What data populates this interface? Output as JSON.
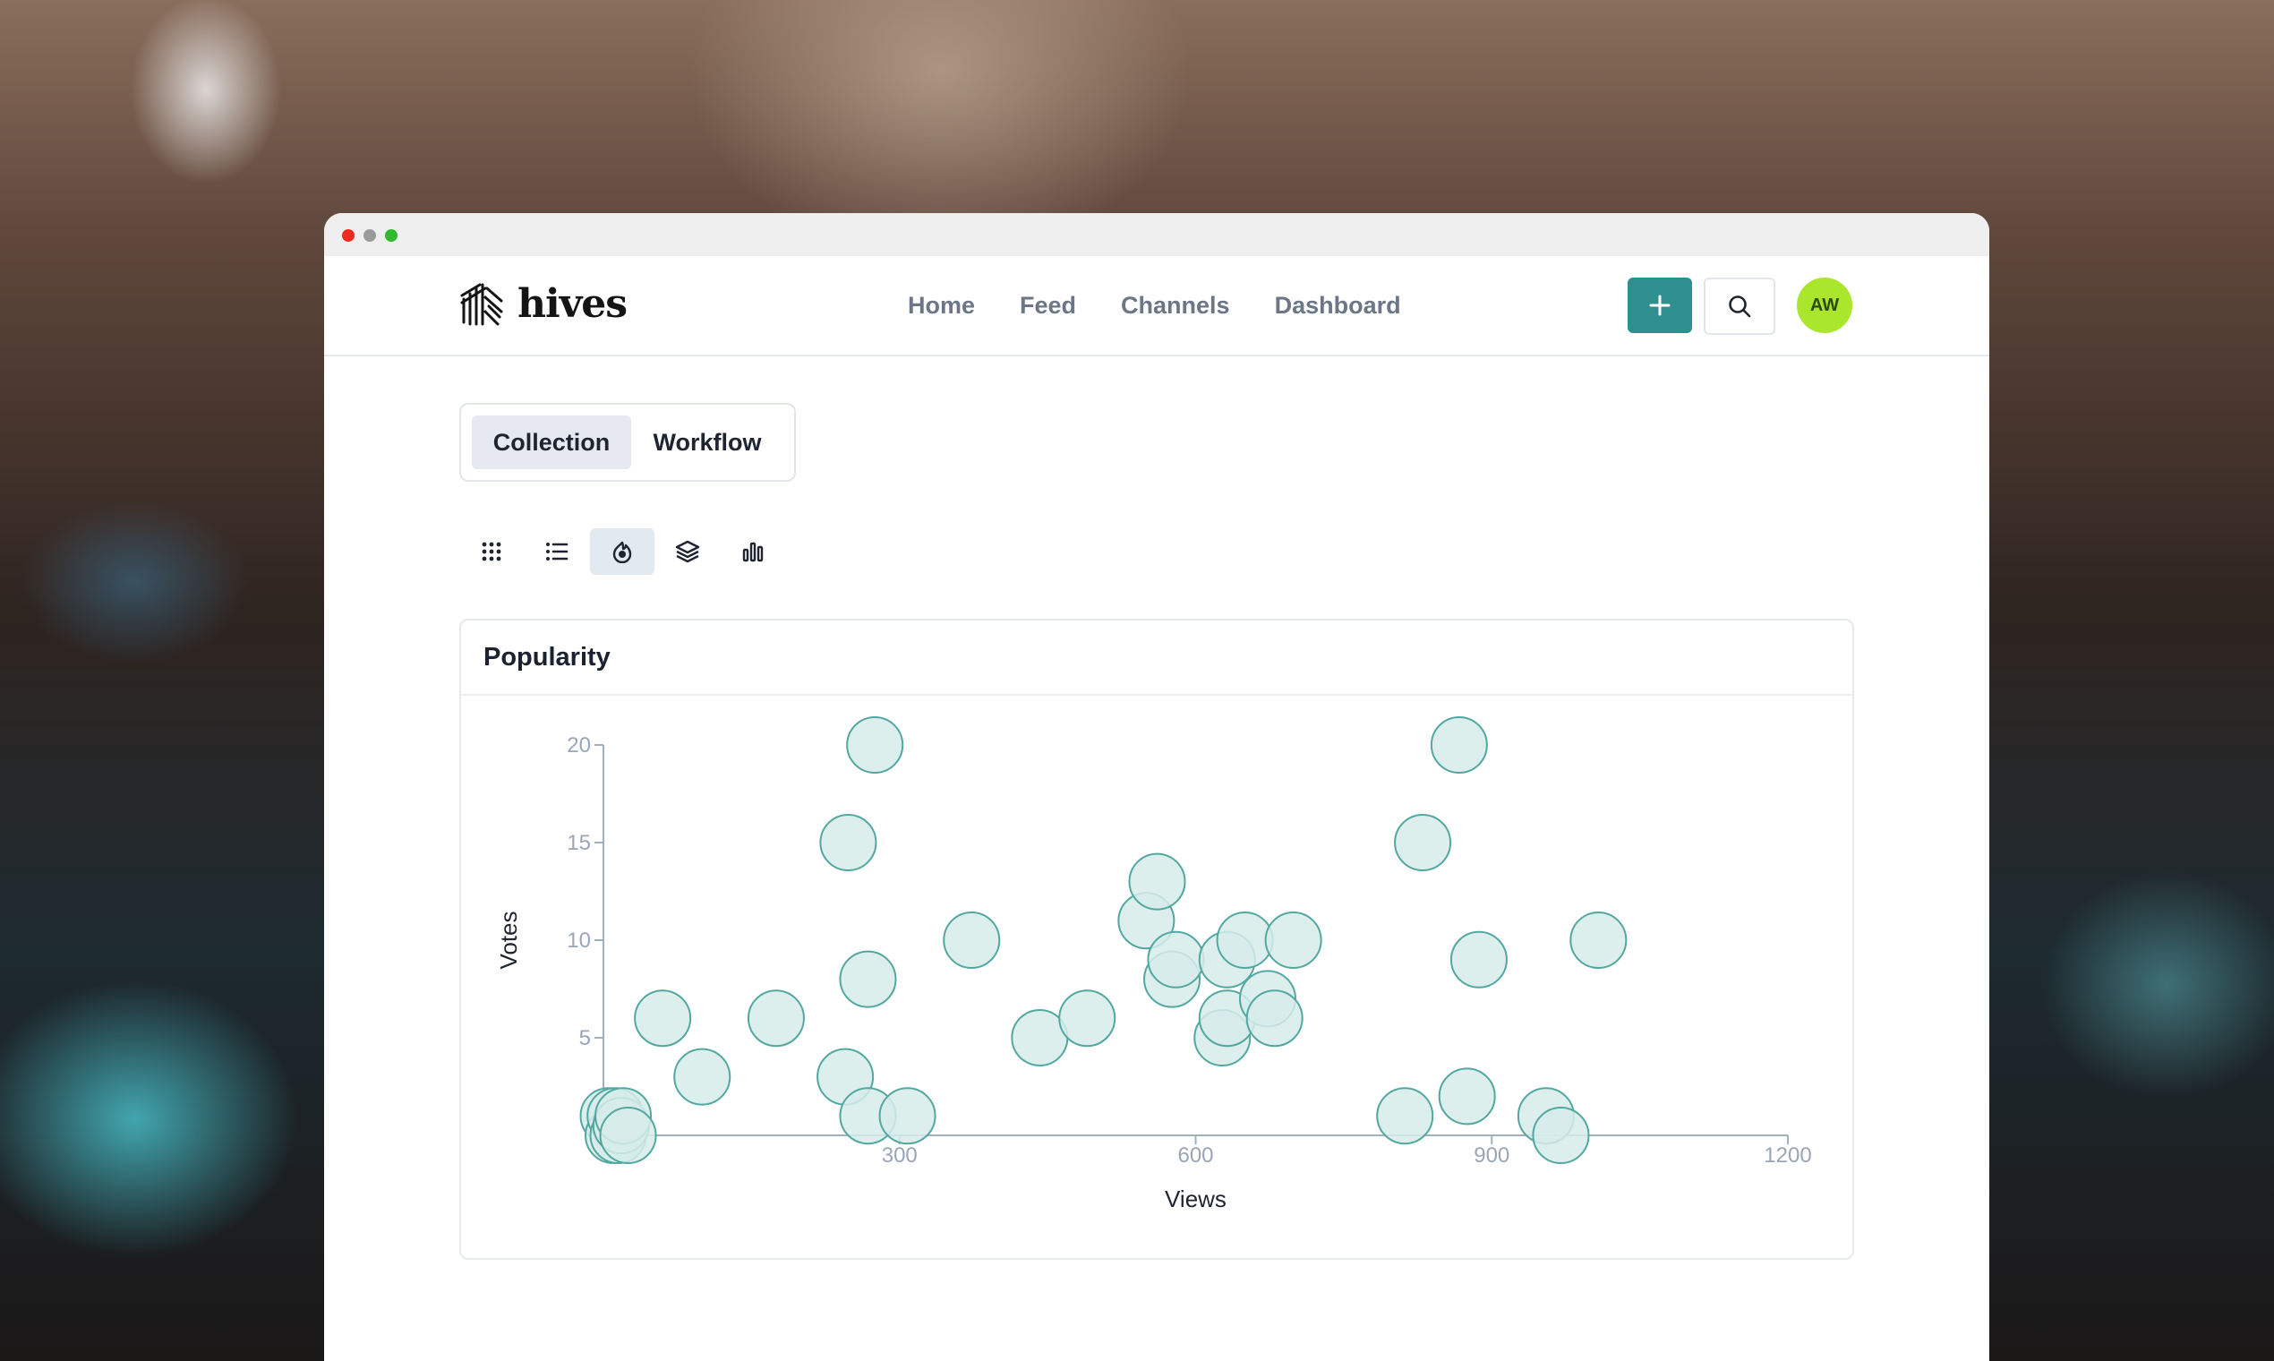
{
  "brand": {
    "name": "hives"
  },
  "nav": {
    "links": [
      "Home",
      "Feed",
      "Channels",
      "Dashboard"
    ]
  },
  "header_actions": {
    "avatar_initials": "AW"
  },
  "tabs": {
    "items": [
      "Collection",
      "Workflow"
    ],
    "active": "Collection"
  },
  "view_modes": {
    "items": [
      "grid-icon",
      "list-icon",
      "popularity-icon",
      "layers-icon",
      "bar-chart-icon"
    ],
    "active": "popularity-icon"
  },
  "chart_card": {
    "title": "Popularity"
  },
  "colors": {
    "accent": "#2f8f8f",
    "bubble_fill": "#d7ecea",
    "bubble_stroke": "#52a8a0",
    "avatar": "#a9e62c"
  },
  "chart_data": {
    "type": "scatter",
    "title": "Popularity",
    "xlabel": "Views",
    "ylabel": "Votes",
    "xlim": [
      0,
      1200
    ],
    "ylim": [
      0,
      20
    ],
    "xticks": [
      300,
      600,
      900,
      1200
    ],
    "yticks": [
      5,
      10,
      15,
      20
    ],
    "grid": false,
    "points": [
      {
        "x": 5,
        "y": 1
      },
      {
        "x": 10,
        "y": 0
      },
      {
        "x": 12,
        "y": 1
      },
      {
        "x": 15,
        "y": 0
      },
      {
        "x": 18,
        "y": 0.5
      },
      {
        "x": 20,
        "y": 1
      },
      {
        "x": 25,
        "y": 0
      },
      {
        "x": 60,
        "y": 6
      },
      {
        "x": 100,
        "y": 3
      },
      {
        "x": 175,
        "y": 6
      },
      {
        "x": 245,
        "y": 3
      },
      {
        "x": 248,
        "y": 15
      },
      {
        "x": 268,
        "y": 8
      },
      {
        "x": 268,
        "y": 1
      },
      {
        "x": 275,
        "y": 20
      },
      {
        "x": 308,
        "y": 1
      },
      {
        "x": 373,
        "y": 10
      },
      {
        "x": 442,
        "y": 5
      },
      {
        "x": 490,
        "y": 6
      },
      {
        "x": 550,
        "y": 11
      },
      {
        "x": 561,
        "y": 13
      },
      {
        "x": 576,
        "y": 8
      },
      {
        "x": 580,
        "y": 9
      },
      {
        "x": 627,
        "y": 5
      },
      {
        "x": 632,
        "y": 6
      },
      {
        "x": 632,
        "y": 9
      },
      {
        "x": 650,
        "y": 10
      },
      {
        "x": 673,
        "y": 7
      },
      {
        "x": 680,
        "y": 6
      },
      {
        "x": 699,
        "y": 10
      },
      {
        "x": 812,
        "y": 1
      },
      {
        "x": 830,
        "y": 15
      },
      {
        "x": 867,
        "y": 20
      },
      {
        "x": 875,
        "y": 2
      },
      {
        "x": 887,
        "y": 9
      },
      {
        "x": 955,
        "y": 1
      },
      {
        "x": 970,
        "y": 0
      },
      {
        "x": 1008,
        "y": 10
      }
    ]
  }
}
